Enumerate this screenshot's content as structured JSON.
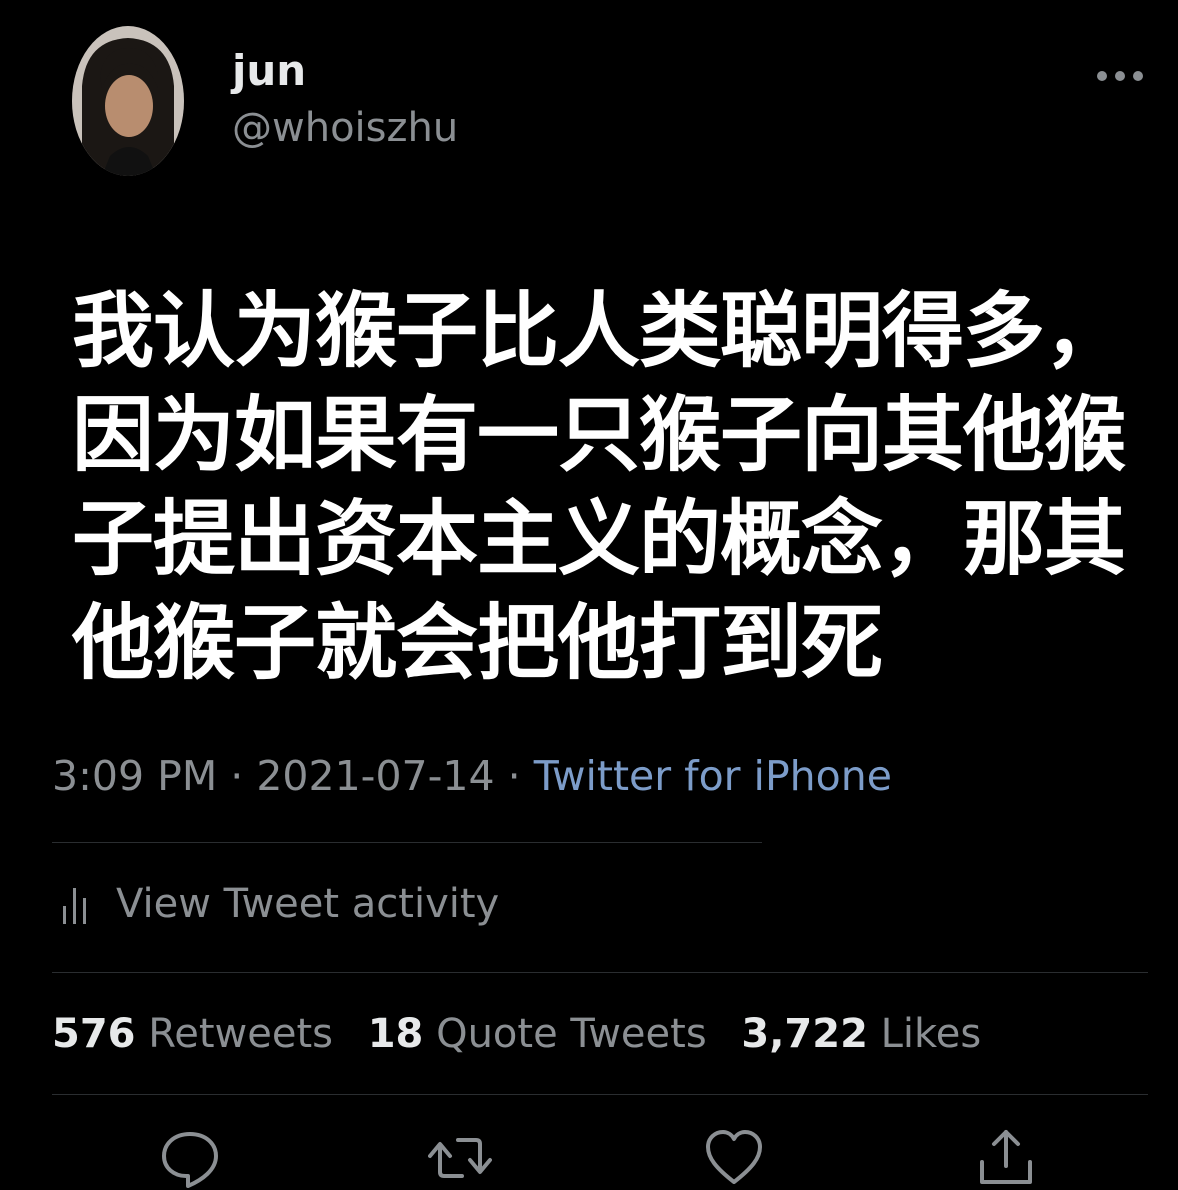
{
  "header": {
    "display_name": "jun",
    "handle": "@whoiszhu"
  },
  "tweet": {
    "text": "我认为猴子比人类聪明得多，因为如果有一只猴子向其他猴子提出资本主义的概念，那其他猴子就会把他打到死",
    "time": "3:09 PM",
    "separator": " · ",
    "date": "2021-07-14",
    "source": "Twitter for iPhone"
  },
  "activity": {
    "label": "View Tweet activity",
    "icon": "bar-chart-icon"
  },
  "stats": {
    "retweets_count": "576",
    "retweets_label": "Retweets",
    "quotes_count": "18",
    "quotes_label": "Quote Tweets",
    "likes_count": "3,722",
    "likes_label": "Likes"
  },
  "actions": {
    "icons": [
      "reply-icon",
      "retweet-icon",
      "like-icon",
      "share-icon"
    ]
  },
  "colors": {
    "background": "#000000",
    "primary_text": "#e7e9ea",
    "secondary_text": "#8b8f93",
    "link": "#7c9cc9",
    "divider": "#2a2d30"
  }
}
